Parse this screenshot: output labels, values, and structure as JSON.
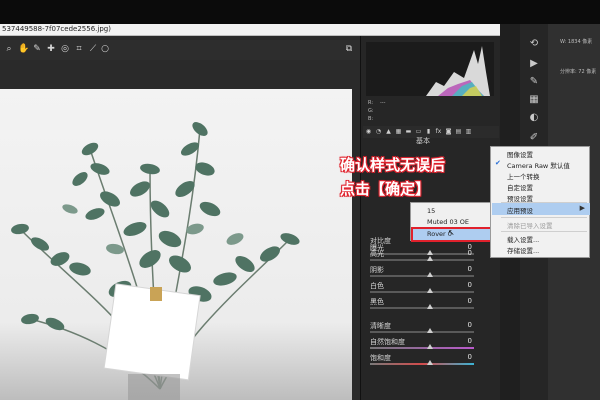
{
  "window": {
    "file_title": "537449588-7f07cede2556.jpg)"
  },
  "toolbar": {
    "tools": [
      "zoom-icon",
      "hand-icon",
      "white-balance-icon",
      "color-sampler-icon",
      "target-adjust-icon",
      "crop-icon",
      "straighten-icon",
      "spot-removal-icon"
    ]
  },
  "raw_panel": {
    "readout": {
      "r": "R:",
      "g": "G:",
      "b": "B:",
      "dash": "---"
    },
    "panel_name": "基本",
    "sliders": [
      {
        "label": "曝光",
        "value": "0"
      },
      {
        "label": "对比度",
        "value": "0"
      },
      {
        "label": "高光",
        "value": "0"
      },
      {
        "label": "阴影",
        "value": "0"
      },
      {
        "label": "白色",
        "value": "0"
      },
      {
        "label": "黑色",
        "value": "0"
      },
      {
        "label": "清晰度",
        "value": "0"
      },
      {
        "label": "自然饱和度",
        "value": "0"
      },
      {
        "label": "饱和度",
        "value": "0"
      }
    ]
  },
  "info_col": {
    "line1": "W: 1834 像素",
    "line2": "分辨率: 72 像素"
  },
  "submenu": {
    "items": [
      "15",
      "Muted 03 OE",
      "Rover 0"
    ],
    "selected": "Rover 0"
  },
  "main_menu": {
    "items": [
      {
        "label": "图像设置",
        "disabled": false
      },
      {
        "label": "Camera Raw 默认值",
        "disabled": false,
        "checked": true
      },
      {
        "label": "上一个转换",
        "disabled": false
      },
      {
        "label": "自定设置",
        "disabled": false
      },
      {
        "label": "预设设置",
        "disabled": false
      },
      {
        "label": "应用预设",
        "disabled": false,
        "highlighted": true,
        "has_submenu": true
      },
      {
        "label": "清除已导入设置",
        "disabled": true
      },
      {
        "label": "载入设置...",
        "disabled": false
      },
      {
        "label": "存储设置...",
        "disabled": false
      }
    ]
  },
  "caption": {
    "line1": "确认样式无误后",
    "line2": "点击【确定】"
  },
  "colors": {
    "caption_stroke": "#e0212c",
    "menu_highlight": "#aecdf0",
    "selection_border": "#e0212c"
  }
}
